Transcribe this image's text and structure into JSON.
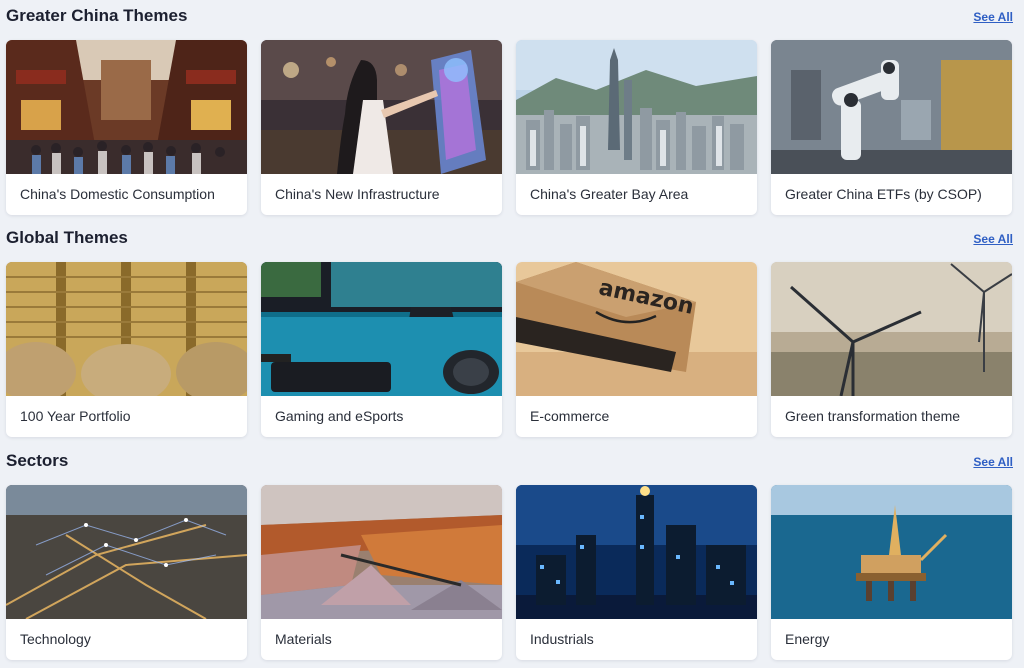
{
  "sections": [
    {
      "title": "Greater China Themes",
      "see_all": "See All",
      "cards": [
        {
          "label": "China's Domestic Consumption",
          "image": "chinese-street-photo"
        },
        {
          "label": "China's New Infrastructure",
          "image": "holographic-interface-photo"
        },
        {
          "label": "China's Greater Bay Area",
          "image": "city-skyline-photo"
        },
        {
          "label": "Greater China ETFs (by CSOP)",
          "image": "robotic-arm-photo"
        }
      ]
    },
    {
      "title": "Global Themes",
      "see_all": "See All",
      "cards": [
        {
          "label": "100 Year Portfolio",
          "image": "coin-stacks-photo"
        },
        {
          "label": "Gaming and eSports",
          "image": "gaming-setup-photo"
        },
        {
          "label": "E-commerce",
          "image": "amazon-box-photo",
          "image_text": "amazon"
        },
        {
          "label": "Green transformation theme",
          "image": "wind-turbines-photo"
        }
      ]
    },
    {
      "title": "Sectors",
      "see_all": "See All",
      "cards": [
        {
          "label": "Technology",
          "image": "network-city-photo"
        },
        {
          "label": "Materials",
          "image": "mining-materials-photo"
        },
        {
          "label": "Industrials",
          "image": "refinery-night-photo"
        },
        {
          "label": "Energy",
          "image": "oil-rig-photo"
        }
      ]
    }
  ],
  "colors": {
    "background": "#eef1f6",
    "card": "#ffffff",
    "link": "#2f5fc4"
  }
}
